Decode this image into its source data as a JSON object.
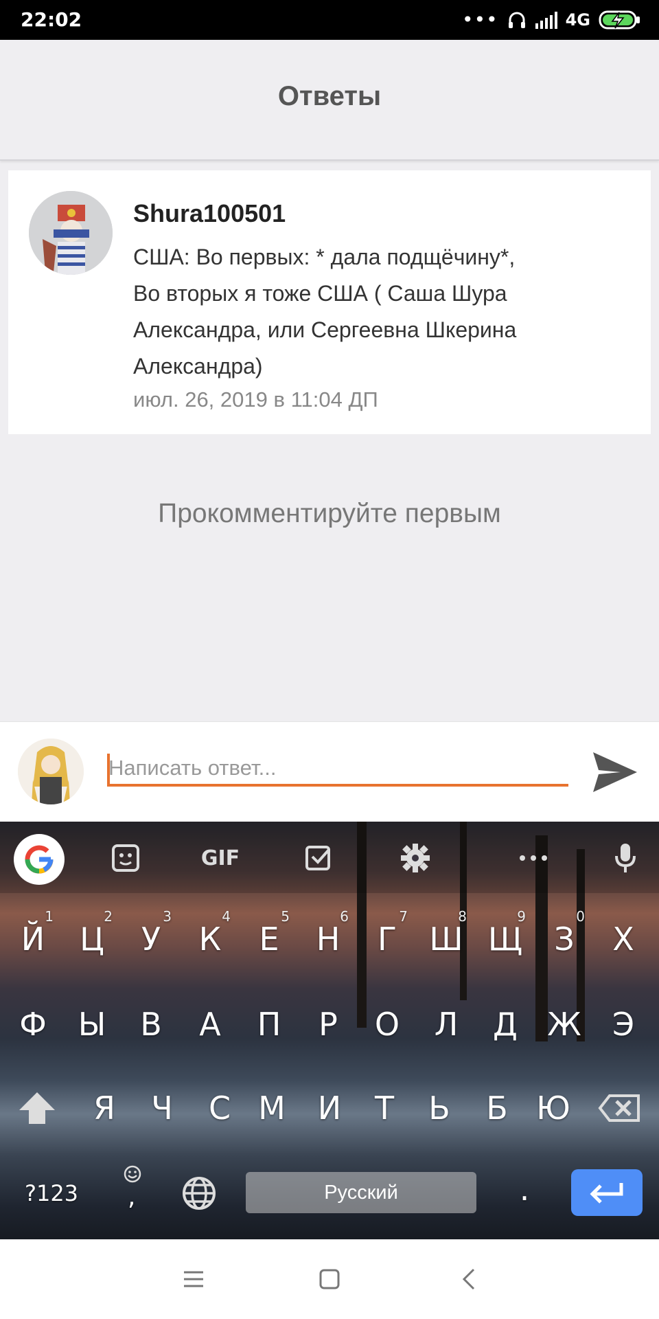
{
  "status_bar": {
    "time": "22:02",
    "dots": "•••",
    "network": "4G"
  },
  "header": {
    "title": "Ответы"
  },
  "comment": {
    "author": "Shura100501",
    "lines": [
      "США: Во первых: * дала подщёчину*,",
      "Во вторых я тоже США ( Саша Шура",
      "Александра, или Сергеевна Шкерина",
      "Александра)"
    ],
    "timestamp": "июл. 26, 2019 в 11:04 ДП"
  },
  "empty_note": "Прокомментируйте первым",
  "reply": {
    "placeholder": "Написать ответ...",
    "value": ""
  },
  "keyboard": {
    "toolbar": {
      "gif_label": "GIF"
    },
    "row1": [
      {
        "key": "Й",
        "hint": "1"
      },
      {
        "key": "Ц",
        "hint": "2"
      },
      {
        "key": "У",
        "hint": "3"
      },
      {
        "key": "К",
        "hint": "4"
      },
      {
        "key": "Е",
        "hint": "5"
      },
      {
        "key": "Н",
        "hint": "6"
      },
      {
        "key": "Г",
        "hint": "7"
      },
      {
        "key": "Ш",
        "hint": "8"
      },
      {
        "key": "Щ",
        "hint": "9"
      },
      {
        "key": "З",
        "hint": "0"
      },
      {
        "key": "Х",
        "hint": ""
      }
    ],
    "row2": [
      "Ф",
      "Ы",
      "В",
      "А",
      "П",
      "Р",
      "О",
      "Л",
      "Д",
      "Ж",
      "Э"
    ],
    "row3": [
      "Я",
      "Ч",
      "С",
      "М",
      "И",
      "Т",
      "Ь",
      "Б",
      "Ю"
    ],
    "symbols_label": "?123",
    "comma_label": ",",
    "space_label": "Русский",
    "period_label": "."
  },
  "colors": {
    "accent": "#e8732f",
    "enter_key": "#4f8ef7",
    "header_bg": "#efeef1"
  }
}
